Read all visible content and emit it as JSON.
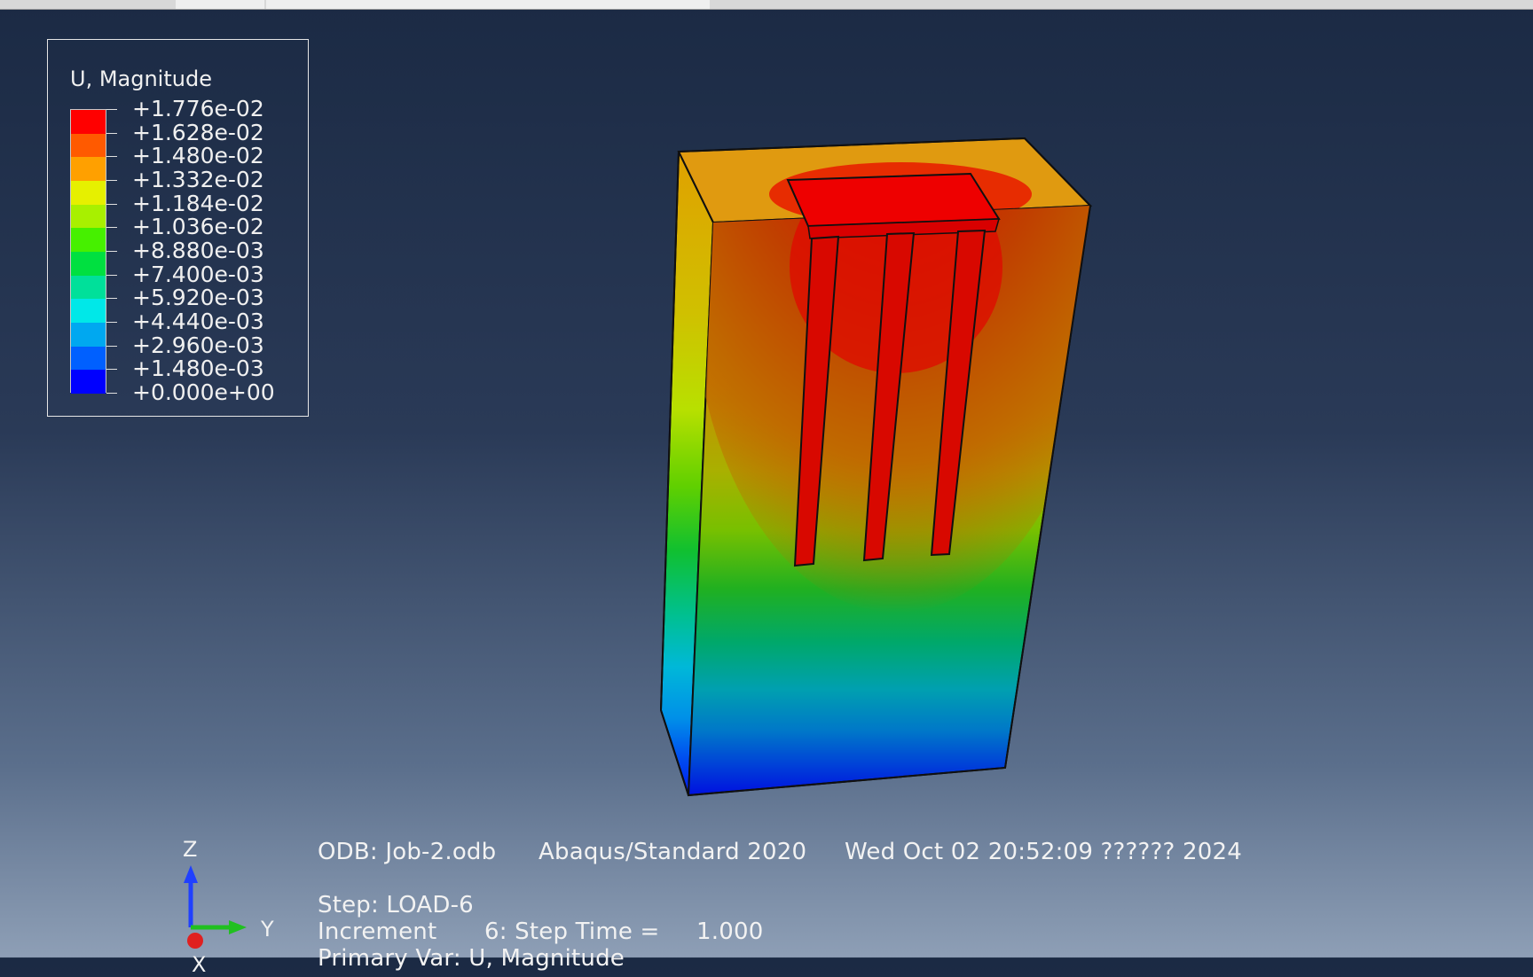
{
  "legend": {
    "title": "U, Magnitude",
    "labels": [
      "+1.776e-02",
      "+1.628e-02",
      "+1.480e-02",
      "+1.332e-02",
      "+1.184e-02",
      "+1.036e-02",
      "+8.880e-03",
      "+7.400e-03",
      "+5.920e-03",
      "+4.440e-03",
      "+2.960e-03",
      "+1.480e-03",
      "+0.000e+00"
    ],
    "colors": [
      "#ff0000",
      "#ff5a00",
      "#ffa000",
      "#e6f000",
      "#a8f000",
      "#46f000",
      "#00e040",
      "#00e09a",
      "#00e8e8",
      "#00a8f0",
      "#0060ff",
      "#0000ff"
    ]
  },
  "info": {
    "odb": "ODB: Job-2.odb",
    "solver": "Abaqus/Standard 2020",
    "date": "Wed Oct 02 20:52:09 ?????? 2024",
    "step": "Step: LOAD-6",
    "increment_label": "Increment",
    "increment_value": "6: Step Time =",
    "step_time": "1.000",
    "primary_var": "Primary Var: U, Magnitude"
  },
  "triad": {
    "z": "Z",
    "y": "Y",
    "x": "X"
  },
  "colors": {
    "x_axis": "#e02020",
    "y_axis": "#20c020",
    "z_axis": "#2040ff"
  }
}
